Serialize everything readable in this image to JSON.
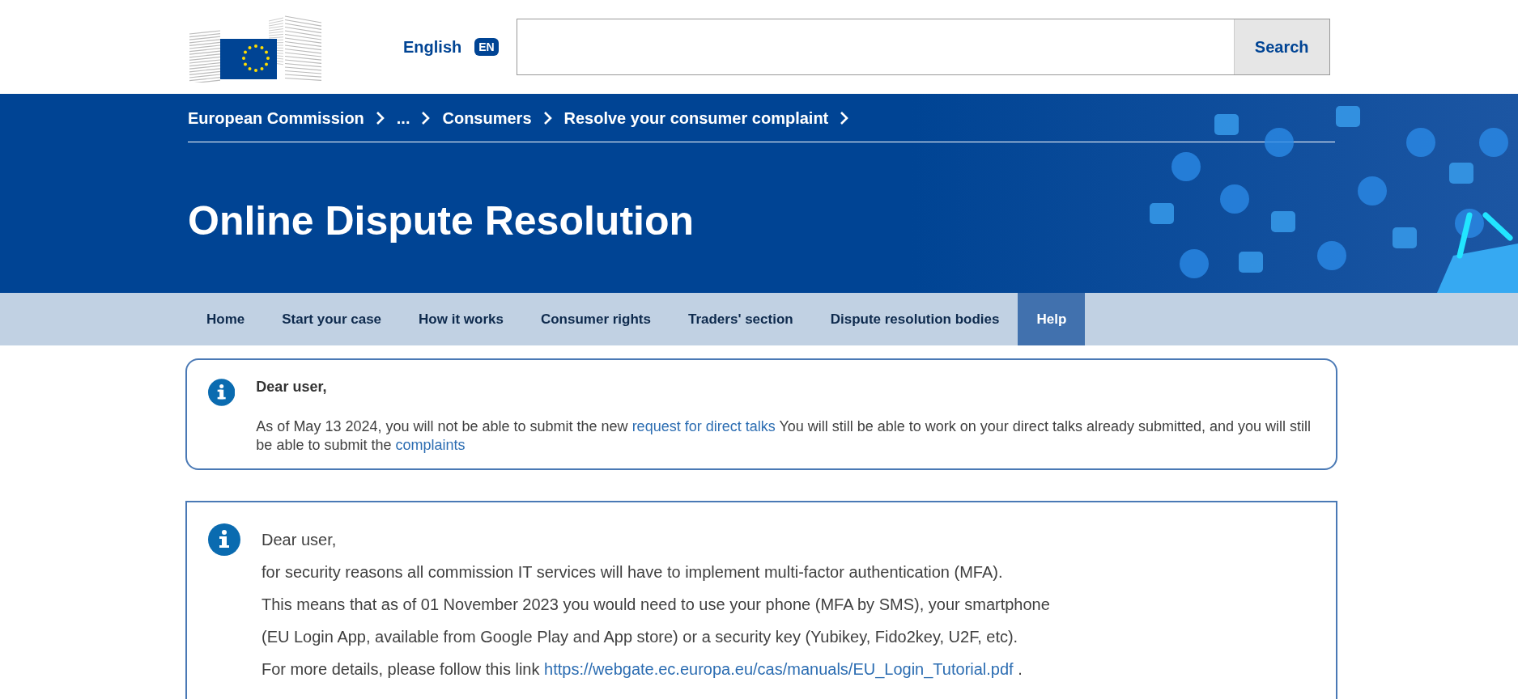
{
  "header": {
    "language": "English",
    "language_code": "EN",
    "search": {
      "button": "Search"
    }
  },
  "breadcrumb": [
    "European Commission",
    "...",
    "Consumers",
    "Resolve your consumer complaint"
  ],
  "page_title": "Online Dispute Resolution",
  "nav": [
    {
      "label": "Home",
      "selected": false
    },
    {
      "label": "Start your case",
      "selected": false
    },
    {
      "label": "How it works",
      "selected": false
    },
    {
      "label": "Consumer rights",
      "selected": false
    },
    {
      "label": "Traders' section",
      "selected": false
    },
    {
      "label": "Dispute resolution bodies",
      "selected": false
    },
    {
      "label": "Help",
      "selected": true
    }
  ],
  "notices": [
    {
      "kind": "rounded",
      "heading": "Dear user,",
      "paragraphs": [
        [
          {
            "kind": "text",
            "text": "As of May 13 2024, you will not be able to submit the new "
          },
          {
            "kind": "link",
            "text": "request for direct talks"
          },
          {
            "kind": "text",
            "text": " You will still be able to work on your direct talks already submitted, and you will still be able to submit the "
          },
          {
            "kind": "link",
            "text": "complaints"
          }
        ]
      ]
    },
    {
      "kind": "square",
      "heading": "Dear user,",
      "paragraphs": [
        [
          {
            "kind": "text",
            "text": "for security reasons all commission IT services will have to implement multi-factor authentication (MFA)."
          }
        ],
        [
          {
            "kind": "text",
            "text": "This means that as of 01 November 2023 you would need to use your phone (MFA by SMS), your smartphone"
          }
        ],
        [
          {
            "kind": "text",
            "text": "(EU Login App, available from Google Play and App store) or a security key (Yubikey, Fido2key, U2F, etc)."
          }
        ],
        [
          {
            "kind": "text",
            "text": "For more details, please follow this link "
          },
          {
            "kind": "link",
            "text": "https://webgate.ec.europa.eu/cas/manuals/EU_Login_Tutorial.pdf"
          },
          {
            "kind": "text",
            "text": " ."
          }
        ]
      ]
    }
  ]
}
